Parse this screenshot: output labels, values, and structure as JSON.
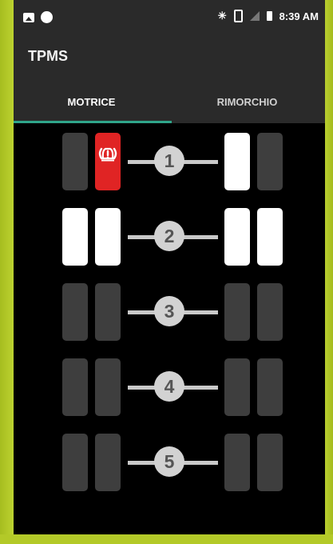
{
  "status_bar": {
    "time": "8:39 AM",
    "icons": [
      "image-icon",
      "circle-icon",
      "bluetooth-icon",
      "vibrate-icon",
      "no-signal-icon",
      "battery-icon"
    ]
  },
  "app_bar": {
    "title": "TPMS"
  },
  "tabs": [
    {
      "label": "MOTRICE",
      "selected": true
    },
    {
      "label": "RIMORCHIO",
      "selected": false
    }
  ],
  "colors": {
    "accent": "#2fa58a",
    "alert": "#e02424",
    "tire_active": "#ffffff",
    "tire_inactive": "#3e3e3e"
  },
  "axles": [
    {
      "number": "1",
      "tires": [
        "inactive",
        "alert",
        "active",
        "inactive"
      ]
    },
    {
      "number": "2",
      "tires": [
        "active",
        "active",
        "active",
        "active"
      ]
    },
    {
      "number": "3",
      "tires": [
        "inactive",
        "inactive",
        "inactive",
        "inactive"
      ]
    },
    {
      "number": "4",
      "tires": [
        "inactive",
        "inactive",
        "inactive",
        "inactive"
      ]
    },
    {
      "number": "5",
      "tires": [
        "inactive",
        "inactive",
        "inactive",
        "inactive"
      ]
    }
  ]
}
